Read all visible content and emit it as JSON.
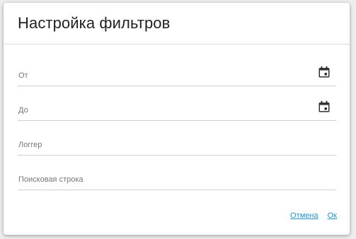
{
  "dialog": {
    "title": "Настройка фильтров",
    "fields": [
      {
        "label": "От",
        "icon": "calendar-icon"
      },
      {
        "label": "До",
        "icon": "calendar-icon"
      },
      {
        "label": "Логгер"
      },
      {
        "label": "Поисковая строка"
      }
    ],
    "actions": {
      "cancel_label": "Отмена",
      "ok_label": "Ок"
    }
  },
  "colors": {
    "accent": "#2196c8",
    "backdrop": "#ededed",
    "surface": "#ffffff"
  }
}
